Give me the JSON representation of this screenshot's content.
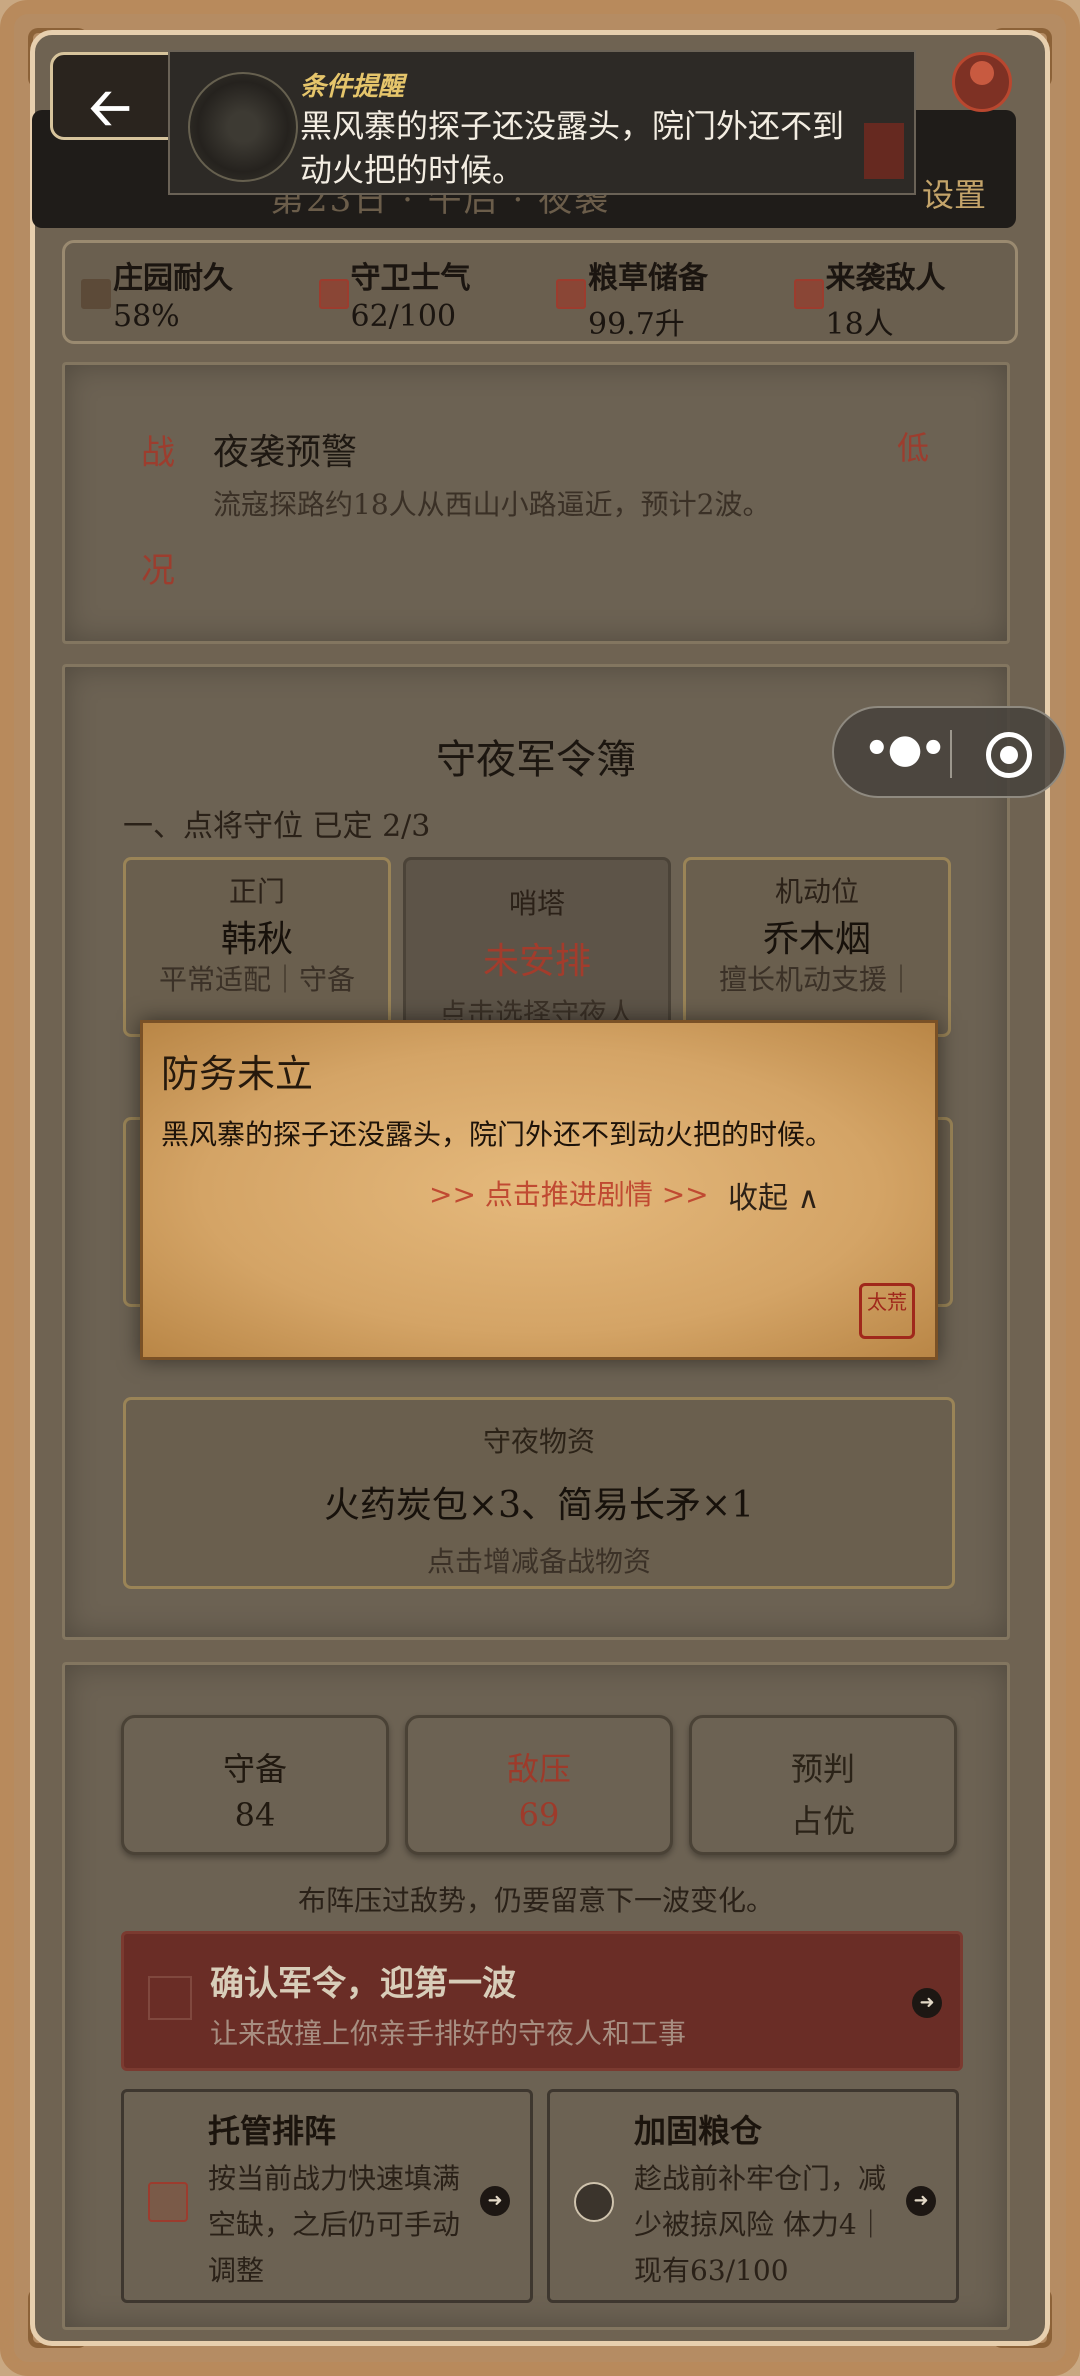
{
  "header": {
    "title_partial": "第23日 · 午后 · 夜袭",
    "settings_label": "设置"
  },
  "notification": {
    "label": "条件提醒",
    "text": "黑风寨的探子还没露头，院门外还不到动火把的时候。"
  },
  "stats": [
    {
      "name": "庄园耐久",
      "value": "58%"
    },
    {
      "name": "守卫士气",
      "value": "62/100"
    },
    {
      "name": "粮草储备",
      "value": "99.7升"
    },
    {
      "name": "来袭敌人",
      "value": "18人"
    }
  ],
  "war": {
    "tag_top": "战",
    "tag_bottom": "况",
    "alert_title": "夜袭预警",
    "alert_level": "低",
    "alert_desc": "流寇探路约18人从西山小路逼近，预计2波。"
  },
  "orders": {
    "title": "守夜军令簿",
    "section1": "一、点将守位  已定 2/3",
    "slots": [
      {
        "role": "正门",
        "name": "韩秋",
        "desc": "平常适配｜守备"
      },
      {
        "role": "哨塔",
        "name": "未安排",
        "desc": "点击选择守夜人"
      },
      {
        "role": "机动位",
        "name": "乔木烟",
        "desc": "擅长机动支援｜"
      }
    ],
    "supply": {
      "label": "守夜物资",
      "items": "火药炭包×3、简易长矛×1",
      "hint": "点击增减备战物资"
    }
  },
  "popup": {
    "title": "防务未立",
    "text": "黑风寨的探子还没露头，院门外还不到动火把的时候。",
    "advance_label": ">> 点击推进剧情 >>",
    "collapse_label": "收起 ∧",
    "seal_text": "太荒"
  },
  "battle": {
    "metrics": [
      {
        "name": "守备",
        "value": "84"
      },
      {
        "name": "敌压",
        "value": "69"
      },
      {
        "name": "预判",
        "value": "占优"
      }
    ],
    "note": "布阵压过敌势，仍要留意下一波变化。",
    "confirm": {
      "title": "确认军令，迎第一波",
      "subtitle": "让来敌撞上你亲手排好的守夜人和工事"
    },
    "actions": [
      {
        "title": "托管排阵",
        "desc": "按当前战力快速填满空缺，之后仍可手动调整"
      },
      {
        "title": "加固粮仓",
        "desc": "趁战前补牢仓门，减少被掠风险 体力4｜现有63/100"
      }
    ]
  },
  "icons": {
    "back": "back-arrow-icon",
    "more": "more-dots-icon",
    "close": "target-circle-icon",
    "action_arrow": "chevron-right-circle-icon"
  },
  "colors": {
    "accent_red": "#9e3a2a",
    "gold": "#e5c56b",
    "confirm_bg": "#6a2d26",
    "parchment": "#d4a466"
  }
}
